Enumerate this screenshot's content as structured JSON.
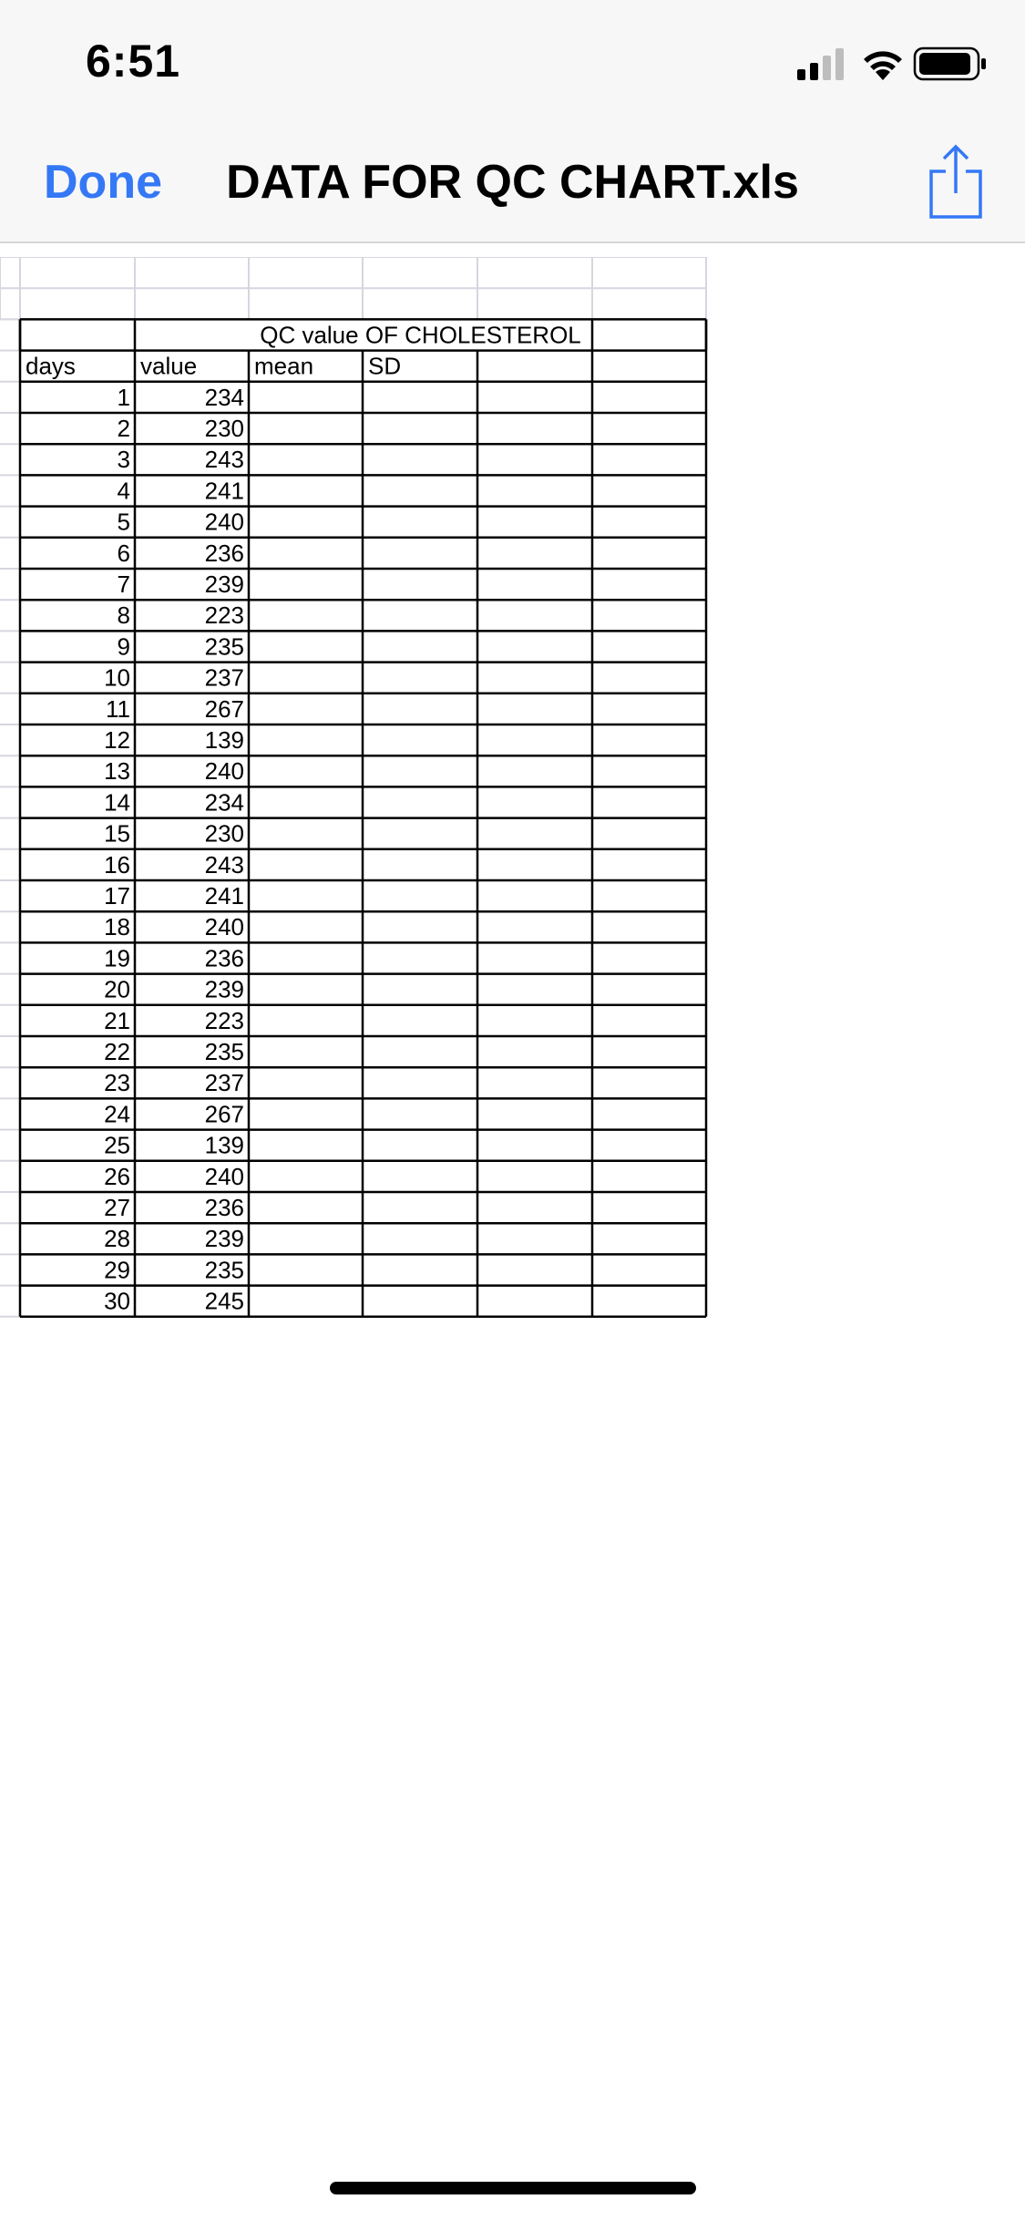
{
  "status_bar": {
    "time": "6:51",
    "icons": [
      "cellular-signal-icon",
      "wifi-icon",
      "battery-icon"
    ]
  },
  "nav": {
    "done_label": "Done",
    "title": "DATA FOR QC CHART.xls",
    "share_icon": "share-icon"
  },
  "sheet": {
    "title": "QC value OF CHOLESTEROL",
    "headers": [
      "days",
      "value",
      "mean",
      "SD"
    ],
    "rows": [
      [
        1,
        234
      ],
      [
        2,
        230
      ],
      [
        3,
        243
      ],
      [
        4,
        241
      ],
      [
        5,
        240
      ],
      [
        6,
        236
      ],
      [
        7,
        239
      ],
      [
        8,
        223
      ],
      [
        9,
        235
      ],
      [
        10,
        237
      ],
      [
        11,
        267
      ],
      [
        12,
        139
      ],
      [
        13,
        240
      ],
      [
        14,
        234
      ],
      [
        15,
        230
      ],
      [
        16,
        243
      ],
      [
        17,
        241
      ],
      [
        18,
        240
      ],
      [
        19,
        236
      ],
      [
        20,
        239
      ],
      [
        21,
        223
      ],
      [
        22,
        235
      ],
      [
        23,
        237
      ],
      [
        24,
        267
      ],
      [
        25,
        139
      ],
      [
        26,
        240
      ],
      [
        27,
        236
      ],
      [
        28,
        239
      ],
      [
        29,
        235
      ],
      [
        30,
        245
      ]
    ]
  },
  "colors": {
    "accent": "#3478f6",
    "gridline": "#d6d6e0",
    "border": "#000000"
  }
}
